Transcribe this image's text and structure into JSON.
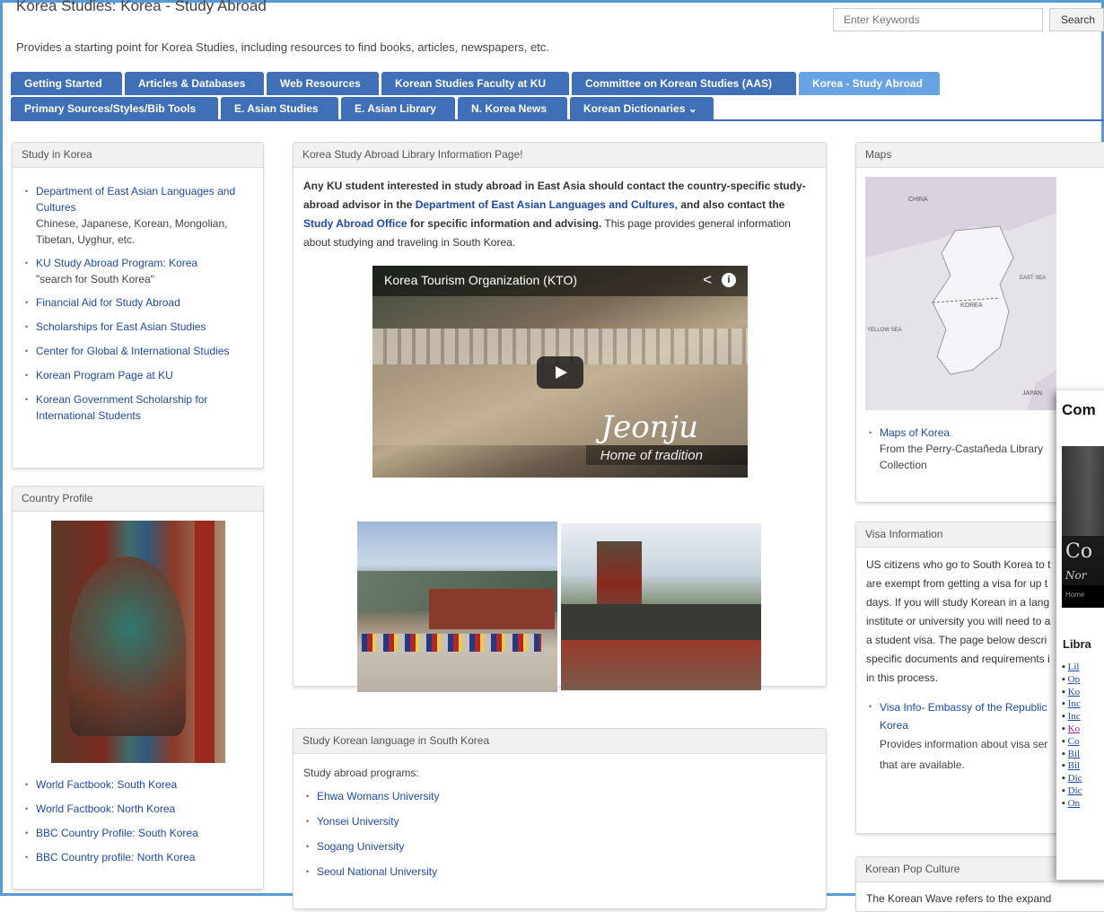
{
  "header": {
    "title": "Korea Studies: Korea - Study Abroad",
    "description": "Provides a starting point for Korea Studies, including resources to find books, articles, newspapers, etc.",
    "search_placeholder": "Enter Keywords",
    "search_button": "Search"
  },
  "tabs_row1": [
    "Getting Started",
    "Articles & Databases",
    "Web Resources",
    "Korean Studies Faculty at KU",
    "Committee on Korean Studies (AAS)",
    "Korea - Study Abroad"
  ],
  "tabs_row2": [
    "Primary Sources/Styles/Bib Tools",
    "E. Asian Studies",
    "E. Asian Library",
    "N. Korea News",
    "Korean Dictionaries ⌄"
  ],
  "study_in_korea": {
    "heading": "Study in Korea",
    "items": [
      {
        "link": "Department of East Asian Languages and Cultures",
        "note": "Chinese, Japanese, Korean, Mongolian, Tibetan, Uyghur, etc."
      },
      {
        "link": "KU Study Abroad Program: Korea",
        "note": "\"search for South Korea\""
      },
      {
        "link": "Financial Aid for Study Abroad",
        "note": ""
      },
      {
        "link": "Scholarships for East Asian Studies",
        "note": ""
      },
      {
        "link": "Center for Global & International Studies",
        "note": ""
      },
      {
        "link": "Korean Program Page at KU",
        "note": ""
      },
      {
        "link": "Korean Government Scholarship for International Students",
        "note": ""
      }
    ]
  },
  "country_profile": {
    "heading": "Country Profile",
    "links": [
      "World Factbook: South Korea",
      "World Factbook: North Korea",
      "BBC Country Profile: South Korea",
      "BBC Country profile: North Korea"
    ]
  },
  "main": {
    "heading": "Korea Study Abroad Library Information Page!",
    "p_bold1": "Any KU student interested in study abroad in East Asia should contact the country-specific study-abroad advisor in the ",
    "p_link1": "Department of East Asian Languages and Cultures,",
    "p_bold2": " and also contact the ",
    "p_link2": "Study Abroad Office",
    "p_bold3": " for specific information and advising.",
    "p_plain": " This page provides general information about studying and traveling in South Korea.",
    "video_title": "Korea Tourism Organization (KTO)",
    "video_caption1": "Jeonju",
    "video_caption2": "Home of tradition"
  },
  "study_korean": {
    "heading": "Study Korean language in South Korea",
    "intro": "Study abroad programs:",
    "items": [
      "Ehwa Womans University",
      "Yonsei University",
      "Sogang University",
      "Seoul National University"
    ]
  },
  "maps": {
    "heading": "Maps",
    "link": "Maps of Korea",
    "note": "From the Perry-Castañeda Library Collection",
    "map_labels": [
      "CHINA",
      "KOREA",
      "EAST SEA",
      "YELLOW SEA",
      "JAPAN"
    ]
  },
  "visa": {
    "heading": "Visa Information",
    "text": "US citizens who go to South Korea to t are exempt from getting a visa for up t days. If you will study Korean in a lang institute or university you will need to a a student visa.  The page below descri specific documents and requirements i in this process.",
    "link": "Visa Info- Embassy of the Republic Korea",
    "note": "Provides information about visa ser that are available."
  },
  "pop_culture": {
    "heading": "Korean Pop Culture",
    "text": "The Korean Wave refers to the expand popularity of Korean music, television dramas,"
  },
  "overlay": {
    "title": "Com",
    "big_letter": "Co",
    "subtitle": "Nor",
    "home": "Home",
    "section": "Libra",
    "links": [
      "Lil",
      "Op",
      "Ko",
      "Inc",
      "Inc",
      "Ko",
      "Co",
      "Bil",
      "Bil",
      "Dic",
      "Dic",
      "On"
    ]
  },
  "colors": {
    "tab": "#3f6fb6",
    "tab_active": "#67a2e3",
    "link": "#1f4aa8"
  }
}
